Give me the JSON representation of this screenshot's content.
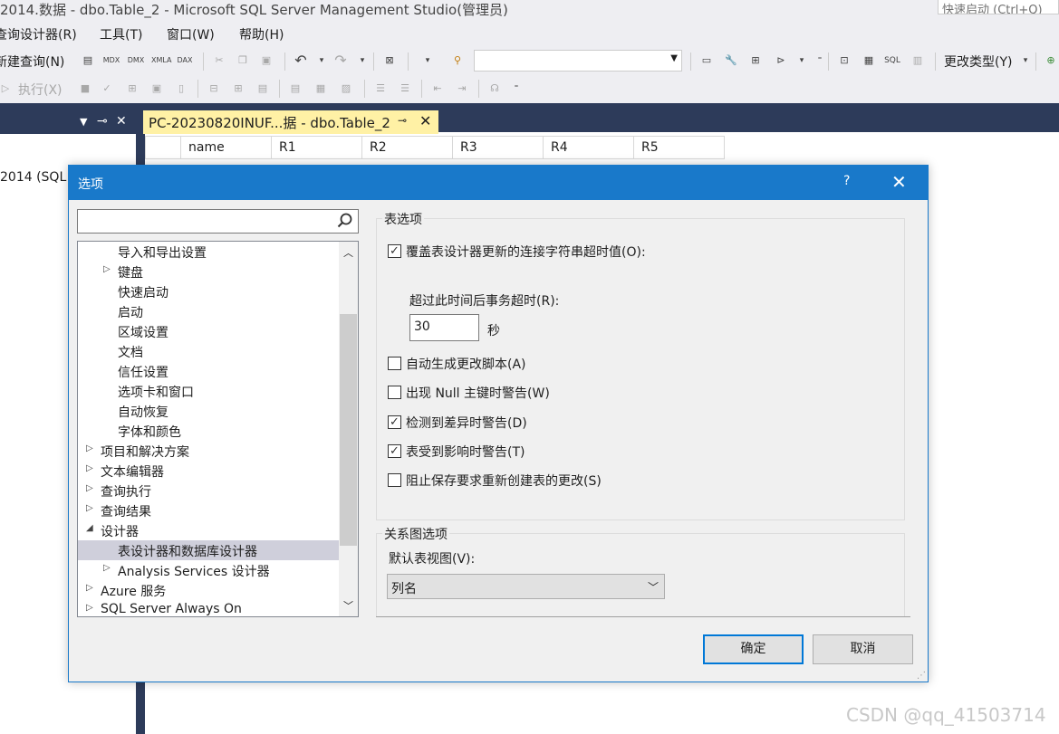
{
  "window": {
    "title": "2014.数据 - dbo.Table_2 - Microsoft SQL Server Management Studio(管理员)",
    "quick_launch_placeholder": "快速启动 (Ctrl+Q)"
  },
  "menu": {
    "items": [
      "查询设计器(R)",
      "工具(T)",
      "窗口(W)",
      "帮助(H)"
    ]
  },
  "toolbar1": {
    "new_query": "新建查询(N)",
    "icons": [
      "MDX",
      "DMX",
      "XMLA",
      "DAX"
    ],
    "change_type": "更改类型(Y)",
    "sql_label": "SQL"
  },
  "toolbar2": {
    "execute": "执行(X)"
  },
  "left_panel": {
    "server_node": "2014 (SQL"
  },
  "doc_tab": {
    "label": "PC-20230820INUF...据 - dbo.Table_2",
    "pin": "⊸",
    "close": "✕"
  },
  "grid": {
    "columns": [
      "name",
      "R1",
      "R2",
      "R3",
      "R4",
      "R5"
    ]
  },
  "dialog": {
    "title": "选项",
    "help": "?",
    "close": "✕",
    "search_placeholder": "",
    "tree": [
      {
        "label": "导入和导出设置",
        "indent": 2,
        "arrow": ""
      },
      {
        "label": "键盘",
        "indent": 2,
        "arrow": "▷"
      },
      {
        "label": "快速启动",
        "indent": 2,
        "arrow": ""
      },
      {
        "label": "启动",
        "indent": 2,
        "arrow": ""
      },
      {
        "label": "区域设置",
        "indent": 2,
        "arrow": ""
      },
      {
        "label": "文档",
        "indent": 2,
        "arrow": ""
      },
      {
        "label": "信任设置",
        "indent": 2,
        "arrow": ""
      },
      {
        "label": "选项卡和窗口",
        "indent": 2,
        "arrow": ""
      },
      {
        "label": "自动恢复",
        "indent": 2,
        "arrow": ""
      },
      {
        "label": "字体和颜色",
        "indent": 2,
        "arrow": ""
      },
      {
        "label": "项目和解决方案",
        "indent": 1,
        "arrow": "▷"
      },
      {
        "label": "文本编辑器",
        "indent": 1,
        "arrow": "▷"
      },
      {
        "label": "查询执行",
        "indent": 1,
        "arrow": "▷"
      },
      {
        "label": "查询结果",
        "indent": 1,
        "arrow": "▷"
      },
      {
        "label": "设计器",
        "indent": 1,
        "arrow": "◢"
      },
      {
        "label": "表设计器和数据库设计器",
        "indent": 2,
        "arrow": "",
        "selected": true
      },
      {
        "label": "Analysis Services 设计器",
        "indent": 2,
        "arrow": "▷"
      },
      {
        "label": "Azure 服务",
        "indent": 1,
        "arrow": "▷"
      },
      {
        "label": "SQL Server Always On",
        "indent": 1,
        "arrow": "▷"
      }
    ],
    "table_options": {
      "group_title": "表选项",
      "override_timeout": {
        "label": "覆盖表设计器更新的连接字符串超时值(O):",
        "checked": true
      },
      "timeout_label": "超过此时间后事务超时(R):",
      "timeout_value": "30",
      "timeout_unit": "秒",
      "auto_script": {
        "label": "自动生成更改脚本(A)",
        "checked": false
      },
      "null_warning": {
        "label": "出现 Null 主键时警告(W)",
        "checked": false
      },
      "diff_warning": {
        "label": "检测到差异时警告(D)",
        "checked": true
      },
      "affected_warning": {
        "label": "表受到影响时警告(T)",
        "checked": true
      },
      "prevent_save": {
        "label": "阻止保存要求重新创建表的更改(S)",
        "checked": false
      }
    },
    "diagram_options": {
      "group_title": "关系图选项",
      "view_label": "默认表视图(V):",
      "view_value": "列名"
    },
    "ok": "确定",
    "cancel": "取消"
  },
  "watermark": "CSDN @qq_41503714"
}
